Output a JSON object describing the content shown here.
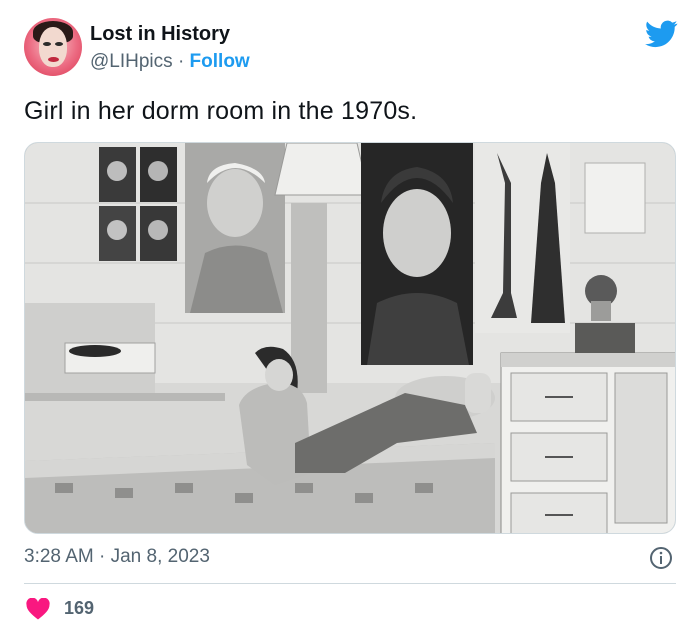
{
  "author": {
    "display_name": "Lost in History",
    "handle": "@LIHpics",
    "separator": "·",
    "follow_label": "Follow"
  },
  "tweet": {
    "text": "Girl in her dorm room in the 1970s.",
    "timestamp": "3:28 AM · Jan 8, 2023",
    "like_count": "169"
  },
  "icons": {
    "brand": "twitter-bird-icon",
    "info": "info-icon",
    "like": "heart-icon"
  },
  "colors": {
    "twitter_blue": "#1d9bf0",
    "heart_red": "#f91880",
    "secondary_text": "#536471",
    "primary_text": "#0f1419",
    "divider": "#cfd9de"
  }
}
